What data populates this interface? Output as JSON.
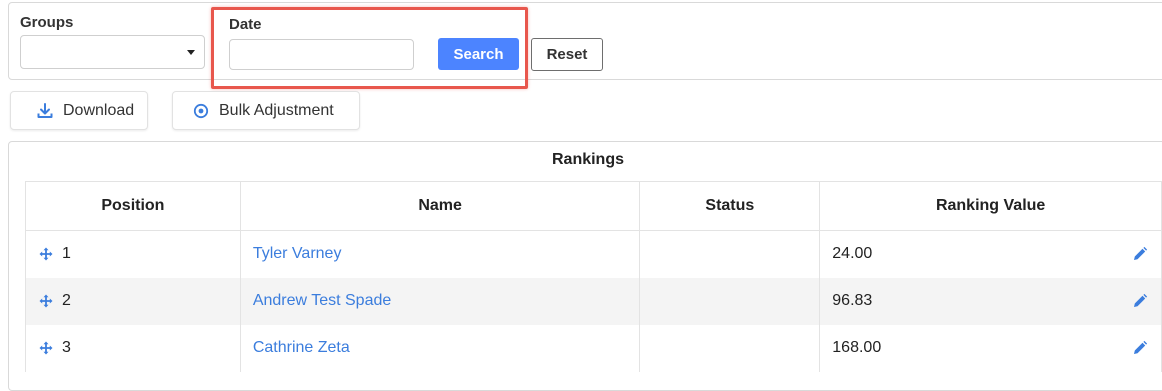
{
  "filters": {
    "groups_label": "Groups",
    "groups_value": "",
    "date_label": "Date",
    "date_value": "",
    "search_label": "Search",
    "reset_label": "Reset"
  },
  "actions": {
    "download_label": "Download",
    "bulk_label": "Bulk Adjustment"
  },
  "table": {
    "caption": "Rankings",
    "headers": [
      "Position",
      "Name",
      "Status",
      "Ranking Value"
    ],
    "rows": [
      {
        "position": "1",
        "name": "Tyler Varney",
        "status": "",
        "value": "24.00"
      },
      {
        "position": "2",
        "name": "Andrew Test Spade",
        "status": "",
        "value": "96.83"
      },
      {
        "position": "3",
        "name": "Cathrine Zeta",
        "status": "",
        "value": "168.00"
      }
    ]
  },
  "colors": {
    "accent": "#4c84ff",
    "link": "#3b7ddd",
    "highlight": "#e8574d"
  }
}
